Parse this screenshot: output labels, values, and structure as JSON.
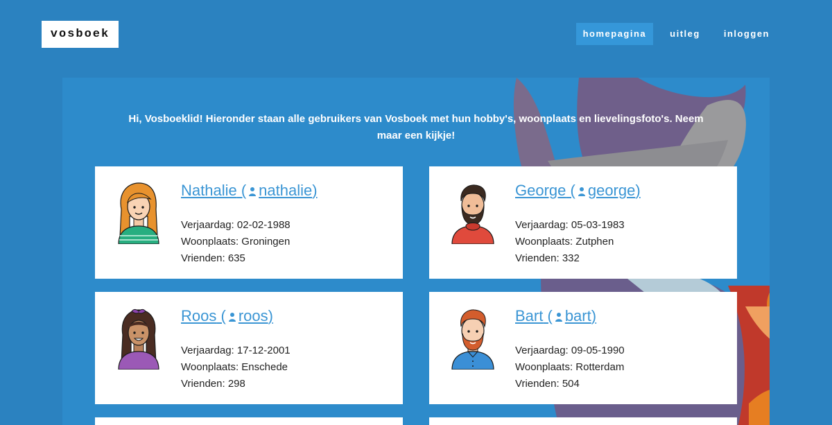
{
  "header": {
    "logo": "vosboek",
    "nav": [
      {
        "label": "homepagina",
        "active": true
      },
      {
        "label": "uitleg",
        "active": false
      },
      {
        "label": "inloggen",
        "active": false
      }
    ]
  },
  "intro": "Hi, Vosboeklid! Hieronder staan alle gebruikers van Vosboek met hun hobby's, woonplaats en lievelingsfoto's. Neem maar een kijkje!",
  "labels": {
    "birthday": "Verjaardag:",
    "city": "Woonplaats:",
    "friends": "Vrienden:"
  },
  "users": [
    {
      "name": "Nathalie",
      "username": "nathalie",
      "birthday": "02-02-1988",
      "city": "Groningen",
      "friends": "635"
    },
    {
      "name": "George",
      "username": "george",
      "birthday": "05-03-1983",
      "city": "Zutphen",
      "friends": "332"
    },
    {
      "name": "Roos",
      "username": "roos",
      "birthday": "17-12-2001",
      "city": "Enschede",
      "friends": "298"
    },
    {
      "name": "Bart",
      "username": "bart",
      "birthday": "09-05-1990",
      "city": "Rotterdam",
      "friends": "504"
    }
  ],
  "colors": {
    "background": "#2b82c0",
    "panel": "#2d8bcb",
    "link": "#3a95d4",
    "nav_active": "#3597d9"
  },
  "icons": {
    "user": "user-icon"
  }
}
